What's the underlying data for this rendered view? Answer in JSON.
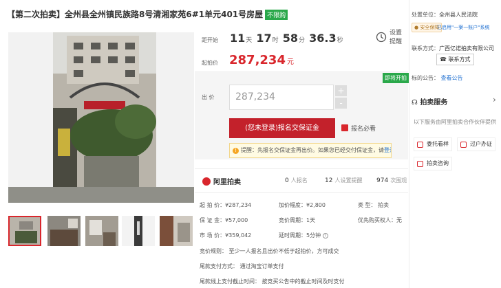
{
  "title": {
    "text": "【第二次拍卖】全州县全州镇民族路8号清湘家苑6#1单元401号房屋",
    "tag": "不限购"
  },
  "countdown": {
    "label": "距开始",
    "days": "11",
    "days_unit": "天",
    "hours": "17",
    "hours_unit": "时",
    "minutes": "58",
    "minutes_unit": "分",
    "seconds": "36.3",
    "seconds_unit": "秒",
    "remind_label": "设置提醒"
  },
  "starting_price": {
    "label": "起拍价",
    "value": "287,234",
    "unit": "元"
  },
  "bid": {
    "badge": "即将开拍",
    "label": "出 价",
    "value": "287,234",
    "plus": "+",
    "minus": "-",
    "signup_button": "(您未登录)报名交保证金",
    "notice_link": "报名必看",
    "tip_prefix": "提醒：先报名交保证金再出价。如果您已经交付保证金，请",
    "tip_link": "登录"
  },
  "stats": {
    "platform": "阿里拍卖",
    "signups_value": "0",
    "signups_label": "人报名",
    "reminders_value": "12",
    "reminders_label": "人设置提醒",
    "views_value": "974",
    "views_label": "次围观"
  },
  "details": {
    "start_price": "起 拍 价：¥287,234",
    "increment": "加价幅度：¥2,800",
    "type": "类     型：   拍卖",
    "deposit": "保 证 金：¥57,000",
    "period": "竞价周期：1天",
    "priority": "优先购买权人：无",
    "market_price": "市 场 价：¥359,042",
    "delay": "延时周期：5分钟",
    "rule": "竞价规则：   至少一人报名且出价不低于起拍价，方可成交",
    "payment": "尾款支付方式：   通过淘宝订单支付",
    "payment_deadline": "尾款线上支付截止时间：   按竞买公告中的截止时间及时支付"
  },
  "right": {
    "court_label": "处置单位：",
    "court_name": "全州县人民法院",
    "security_pill": "安全保障",
    "connected": "已启用\"一案一账户\"系统",
    "contact_label": "联系方式：",
    "contact_company": "广西亿诺拍卖有限公司",
    "contact_button": "联系方式",
    "announcement_label": "标的公告：",
    "announcement_link": "查看公告",
    "service_title": "拍卖服务",
    "service_arrow": "›",
    "service_desc": "以下服务由阿里拍卖合作伙伴提供",
    "service_items": [
      "委托看样",
      "过户办证",
      "拍卖咨询"
    ]
  },
  "thumbs_count_label": ""
}
